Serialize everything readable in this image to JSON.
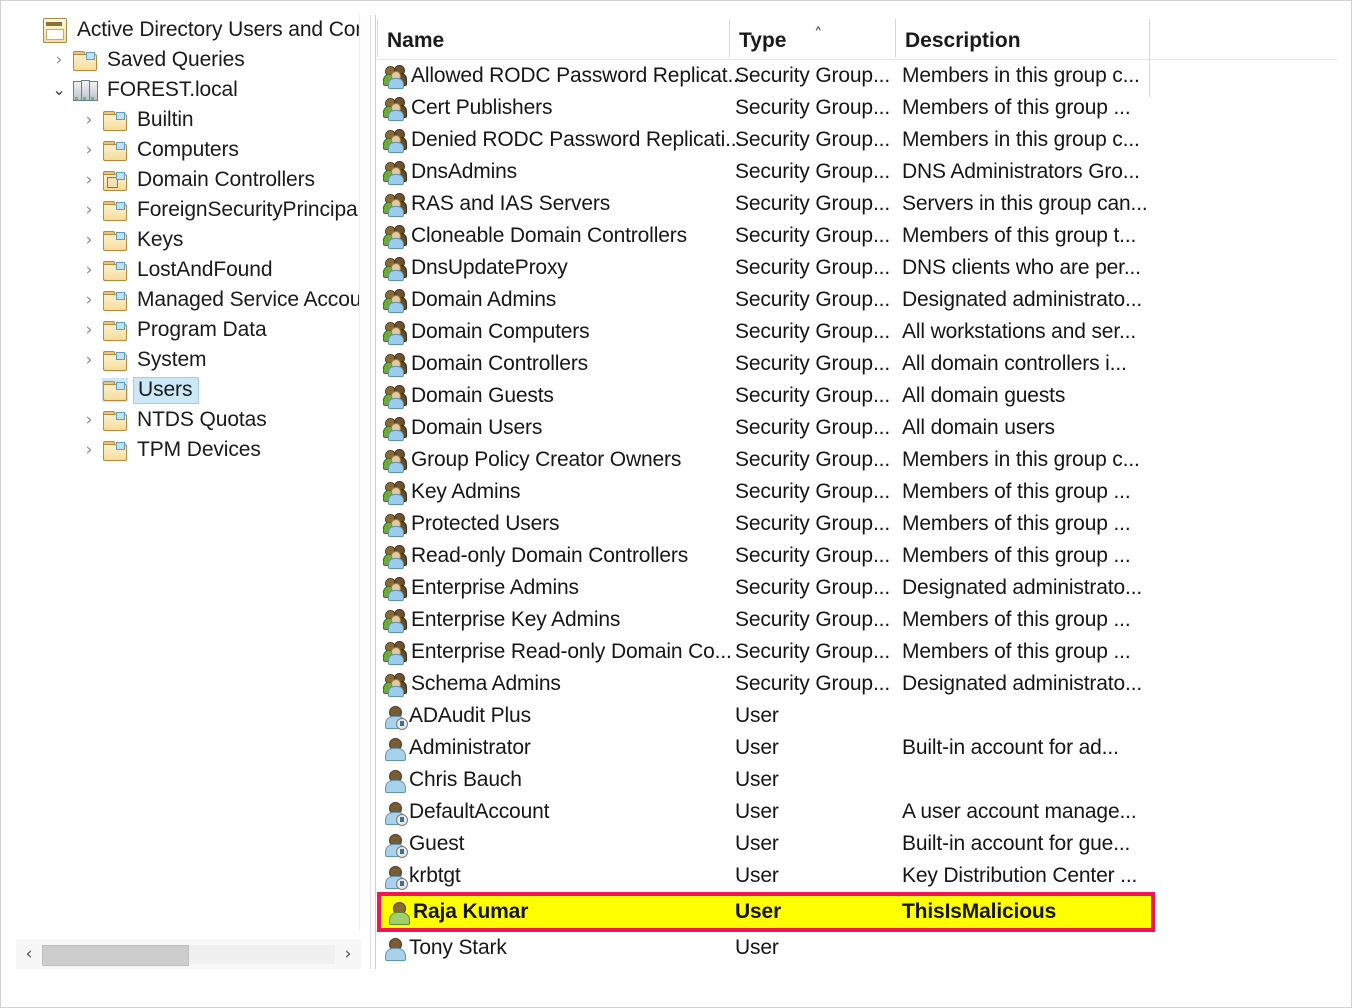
{
  "window": {
    "title": "Active Directory Users and Computers"
  },
  "tree": {
    "root_label": "Active Directory Users and Com",
    "items": [
      {
        "label": "Active Directory Users and Com",
        "icon": "console-icon",
        "indent": 0,
        "twisty": "",
        "selected": false
      },
      {
        "label": "Saved Queries",
        "icon": "folder-icon",
        "indent": 1,
        "twisty": ">",
        "selected": false
      },
      {
        "label": "FOREST.local",
        "icon": "domain-icon",
        "indent": 1,
        "twisty": "v",
        "selected": false
      },
      {
        "label": "Builtin",
        "icon": "folder-icon",
        "indent": 2,
        "twisty": ">",
        "selected": false
      },
      {
        "label": "Computers",
        "icon": "folder-icon",
        "indent": 2,
        "twisty": ">",
        "selected": false
      },
      {
        "label": "Domain Controllers",
        "icon": "folder-dc-icon",
        "indent": 2,
        "twisty": ">",
        "selected": false
      },
      {
        "label": "ForeignSecurityPrincipals",
        "icon": "folder-icon",
        "indent": 2,
        "twisty": ">",
        "selected": false
      },
      {
        "label": "Keys",
        "icon": "folder-icon",
        "indent": 2,
        "twisty": ">",
        "selected": false
      },
      {
        "label": "LostAndFound",
        "icon": "folder-icon",
        "indent": 2,
        "twisty": ">",
        "selected": false
      },
      {
        "label": "Managed Service Accoun",
        "icon": "folder-icon",
        "indent": 2,
        "twisty": ">",
        "selected": false
      },
      {
        "label": "Program Data",
        "icon": "folder-icon",
        "indent": 2,
        "twisty": ">",
        "selected": false
      },
      {
        "label": "System",
        "icon": "folder-icon",
        "indent": 2,
        "twisty": ">",
        "selected": false
      },
      {
        "label": "Users",
        "icon": "folder-icon",
        "indent": 2,
        "twisty": "",
        "selected": true
      },
      {
        "label": "NTDS Quotas",
        "icon": "folder-icon",
        "indent": 2,
        "twisty": ">",
        "selected": false
      },
      {
        "label": "TPM Devices",
        "icon": "folder-icon",
        "indent": 2,
        "twisty": ">",
        "selected": false
      }
    ],
    "hscroll": {
      "left_arrow": "‹",
      "right_arrow": "›"
    }
  },
  "list": {
    "columns": [
      {
        "key": "name",
        "label": "Name"
      },
      {
        "key": "type",
        "label": "Type"
      },
      {
        "key": "description",
        "label": "Description"
      }
    ],
    "sort": {
      "column": "Type",
      "caret": "˄"
    },
    "rows": [
      {
        "name": "Allowed RODC Password Replicat...",
        "type": "Security Group...",
        "description": "Members in this group c...",
        "icon": "group-icon",
        "highlighted": false
      },
      {
        "name": "Cert Publishers",
        "type": "Security Group...",
        "description": "Members of this group ...",
        "icon": "group-icon",
        "highlighted": false
      },
      {
        "name": "Denied RODC Password Replicati...",
        "type": "Security Group...",
        "description": "Members in this group c...",
        "icon": "group-icon",
        "highlighted": false
      },
      {
        "name": "DnsAdmins",
        "type": "Security Group...",
        "description": "DNS Administrators Gro...",
        "icon": "group-icon",
        "highlighted": false
      },
      {
        "name": "RAS and IAS Servers",
        "type": "Security Group...",
        "description": "Servers in this group can...",
        "icon": "group-icon",
        "highlighted": false
      },
      {
        "name": "Cloneable Domain Controllers",
        "type": "Security Group...",
        "description": "Members of this group t...",
        "icon": "group-icon",
        "highlighted": false
      },
      {
        "name": "DnsUpdateProxy",
        "type": "Security Group...",
        "description": "DNS clients who are per...",
        "icon": "group-icon",
        "highlighted": false
      },
      {
        "name": "Domain Admins",
        "type": "Security Group...",
        "description": "Designated administrato...",
        "icon": "group-icon",
        "highlighted": false
      },
      {
        "name": "Domain Computers",
        "type": "Security Group...",
        "description": "All workstations and ser...",
        "icon": "group-icon",
        "highlighted": false
      },
      {
        "name": "Domain Controllers",
        "type": "Security Group...",
        "description": "All domain controllers i...",
        "icon": "group-icon",
        "highlighted": false
      },
      {
        "name": "Domain Guests",
        "type": "Security Group...",
        "description": "All domain guests",
        "icon": "group-icon",
        "highlighted": false
      },
      {
        "name": "Domain Users",
        "type": "Security Group...",
        "description": "All domain users",
        "icon": "group-icon",
        "highlighted": false
      },
      {
        "name": "Group Policy Creator Owners",
        "type": "Security Group...",
        "description": "Members in this group c...",
        "icon": "group-icon",
        "highlighted": false
      },
      {
        "name": "Key Admins",
        "type": "Security Group...",
        "description": "Members of this group ...",
        "icon": "group-icon",
        "highlighted": false
      },
      {
        "name": "Protected Users",
        "type": "Security Group...",
        "description": "Members of this group ...",
        "icon": "group-icon",
        "highlighted": false
      },
      {
        "name": "Read-only Domain Controllers",
        "type": "Security Group...",
        "description": "Members of this group ...",
        "icon": "group-icon",
        "highlighted": false
      },
      {
        "name": "Enterprise Admins",
        "type": "Security Group...",
        "description": "Designated administrato...",
        "icon": "group-icon",
        "highlighted": false
      },
      {
        "name": "Enterprise Key Admins",
        "type": "Security Group...",
        "description": "Members of this group ...",
        "icon": "group-icon",
        "highlighted": false
      },
      {
        "name": "Enterprise Read-only Domain Co...",
        "type": "Security Group...",
        "description": "Members of this group ...",
        "icon": "group-icon",
        "highlighted": false
      },
      {
        "name": "Schema Admins",
        "type": "Security Group...",
        "description": "Designated administrato...",
        "icon": "group-icon",
        "highlighted": false
      },
      {
        "name": "ADAudit Plus",
        "type": "User",
        "description": "",
        "icon": "user-special-icon",
        "highlighted": false
      },
      {
        "name": "Administrator",
        "type": "User",
        "description": "Built-in account for ad...",
        "icon": "user-icon",
        "highlighted": false
      },
      {
        "name": "Chris Bauch",
        "type": "User",
        "description": "",
        "icon": "user-icon",
        "highlighted": false
      },
      {
        "name": "DefaultAccount",
        "type": "User",
        "description": "A user account manage...",
        "icon": "user-special-icon",
        "highlighted": false
      },
      {
        "name": "Guest",
        "type": "User",
        "description": "Built-in account for gue...",
        "icon": "user-special-icon",
        "highlighted": false
      },
      {
        "name": "krbtgt",
        "type": "User",
        "description": "Key Distribution Center ...",
        "icon": "user-special-icon",
        "highlighted": false
      },
      {
        "name": "Raja Kumar",
        "type": "User",
        "description": "ThisIsMalicious",
        "icon": "user-icon",
        "highlighted": true
      },
      {
        "name": "Tony Stark",
        "type": "User",
        "description": "",
        "icon": "user-icon",
        "highlighted": false
      }
    ]
  },
  "colors": {
    "highlight_fill": "#ffff00",
    "highlight_border": "#ef1750",
    "tree_selection": "#cce8f7",
    "frame_border": "#d2d2d2"
  }
}
